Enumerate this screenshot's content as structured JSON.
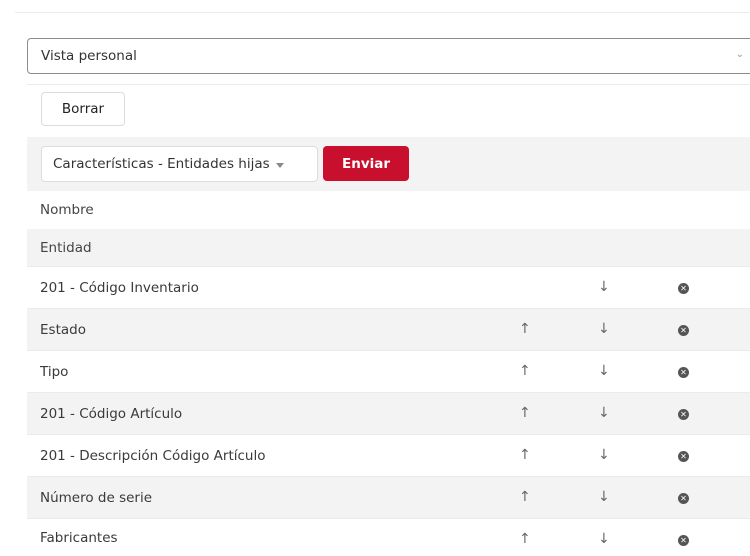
{
  "view_select": {
    "value": "Vista personal"
  },
  "toolbar": {
    "borrar_label": "Borrar"
  },
  "form": {
    "dropdown_label": "Características - Entidades hijas",
    "enviar_label": "Enviar"
  },
  "headers": {
    "nombre": "Nombre",
    "entidad": "Entidad"
  },
  "rows": [
    {
      "label": "201 - Código Inventario",
      "up": "",
      "down": "↓"
    },
    {
      "label": "Estado",
      "up": "↑",
      "down": "↓"
    },
    {
      "label": "Tipo",
      "up": "↑",
      "down": "↓"
    },
    {
      "label": "201 - Código Artículo",
      "up": "↑",
      "down": "↓"
    },
    {
      "label": "201 - Descripción Código Artículo",
      "up": "↑",
      "down": "↓"
    },
    {
      "label": "Número de serie",
      "up": "↑",
      "down": "↓"
    },
    {
      "label": "Fabricantes",
      "up": "↑",
      "down": "↓"
    }
  ],
  "icons": {
    "up": "arrow-up-icon",
    "down": "arrow-down-icon",
    "remove": "remove-circle-icon"
  },
  "colors": {
    "enviar_bg": "#c8102e",
    "band_gray": "#f3f3f3"
  }
}
